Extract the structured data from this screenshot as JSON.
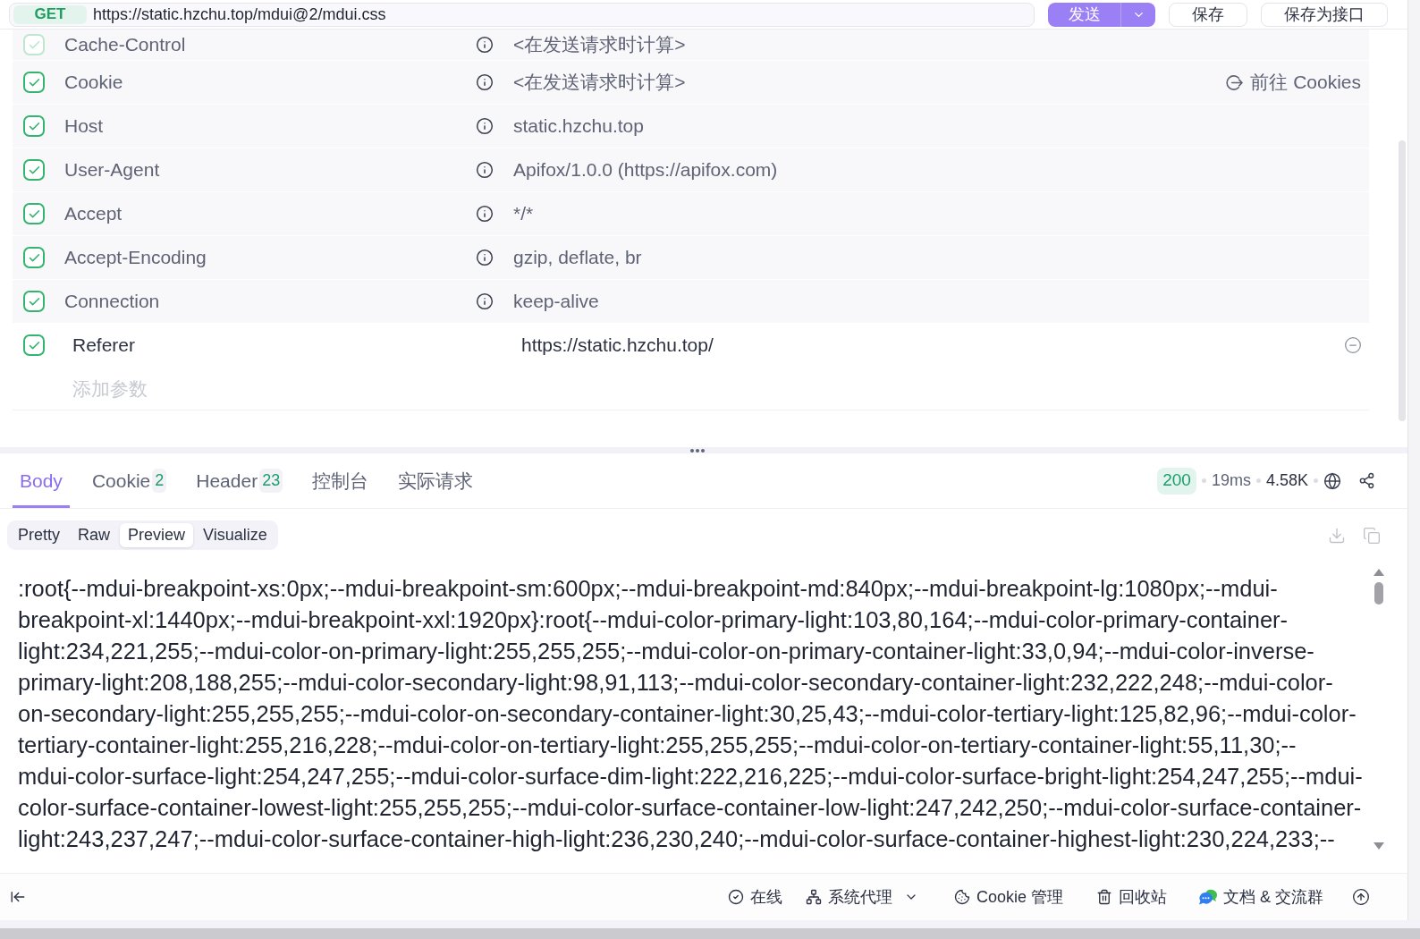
{
  "request_bar": {
    "method": "GET",
    "url": "https://static.hzchu.top/mdui@2/mdui.css",
    "buttons": [
      {
        "label": "发送",
        "kind": "split_primary"
      },
      {
        "label": "保存",
        "kind": "default"
      },
      {
        "label": "保存为接口",
        "kind": "default"
      }
    ]
  },
  "headers": {
    "rows": [
      {
        "kind": "auto",
        "checked": true,
        "disabled": true,
        "name": "Cache-Control",
        "value": "<在发送请求时计算>"
      },
      {
        "kind": "auto",
        "checked": true,
        "disabled": false,
        "name": "Cookie",
        "value": "<在发送请求时计算>",
        "link": "前往 Cookies"
      },
      {
        "kind": "auto",
        "checked": true,
        "disabled": false,
        "name": "Host",
        "value": "static.hzchu.top"
      },
      {
        "kind": "auto",
        "checked": true,
        "disabled": false,
        "name": "User-Agent",
        "value": "Apifox/1.0.0 (https://apifox.com)"
      },
      {
        "kind": "auto",
        "checked": true,
        "disabled": false,
        "name": "Accept",
        "value": "*/*"
      },
      {
        "kind": "auto",
        "checked": true,
        "disabled": false,
        "name": "Accept-Encoding",
        "value": "gzip, deflate, br"
      },
      {
        "kind": "auto",
        "checked": true,
        "disabled": false,
        "name": "Connection",
        "value": "keep-alive"
      },
      {
        "kind": "custom",
        "checked": true,
        "disabled": false,
        "name": "Referer",
        "value": "https://static.hzchu.top/"
      }
    ],
    "add_placeholder": "添加参数"
  },
  "response": {
    "tabs": [
      {
        "label": "Body",
        "selected": true
      },
      {
        "label": "Cookie",
        "count": "2",
        "selected": false
      },
      {
        "label": "Header",
        "count": "23",
        "selected": false
      },
      {
        "label": "控制台",
        "selected": false
      },
      {
        "label": "实际请求",
        "selected": false
      }
    ],
    "status_code": "200",
    "time": "19ms",
    "size": "4.58K",
    "view_modes": [
      {
        "label": "Pretty",
        "selected": false
      },
      {
        "label": "Raw",
        "selected": false
      },
      {
        "label": "Preview",
        "selected": true
      },
      {
        "label": "Visualize",
        "selected": false
      }
    ],
    "body_lines": [
      ":root{--mdui-breakpoint-xs:0px;--mdui-breakpoint-sm:600px;--mdui-breakpoint-md:840px;--mdui-breakpoint-lg:1080px;--mdui-",
      "breakpoint-xl:1440px;--mdui-breakpoint-xxl:1920px}:root{--mdui-color-primary-light:103,80,164;--mdui-color-primary-container-",
      "light:234,221,255;--mdui-color-on-primary-light:255,255,255;--mdui-color-on-primary-container-light:33,0,94;--mdui-color-inverse-",
      "primary-light:208,188,255;--mdui-color-secondary-light:98,91,113;--mdui-color-secondary-container-light:232,222,248;--mdui-color-",
      "on-secondary-light:255,255,255;--mdui-color-on-secondary-container-light:30,25,43;--mdui-color-tertiary-light:125,82,96;--mdui-color-",
      "tertiary-container-light:255,216,228;--mdui-color-on-tertiary-light:255,255,255;--mdui-color-on-tertiary-container-light:55,11,30;--",
      "mdui-color-surface-light:254,247,255;--mdui-color-surface-dim-light:222,216,225;--mdui-color-surface-bright-light:254,247,255;--mdui-",
      "color-surface-container-lowest-light:255,255,255;--mdui-color-surface-container-low-light:247,242,250;--mdui-color-surface-container-",
      "light:243,237,247;--mdui-color-surface-container-high-light:236,230,240;--mdui-color-surface-container-highest-light:230,224,233;--"
    ]
  },
  "status_bar": {
    "items": [
      {
        "kind": "online",
        "label": "在线"
      },
      {
        "kind": "proxy",
        "label": "系统代理"
      },
      {
        "kind": "cookie",
        "label": "Cookie 管理"
      },
      {
        "kind": "trash",
        "label": "回收站"
      },
      {
        "kind": "chat",
        "label": "文档 & 交流群"
      }
    ]
  }
}
